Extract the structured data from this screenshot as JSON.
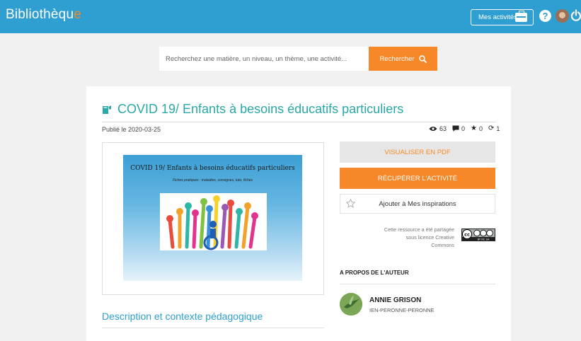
{
  "header": {
    "brand_main": "Bibliothèqu",
    "brand_accent": "e",
    "my_activities": "Mes activités",
    "help": "?"
  },
  "search": {
    "placeholder": "Recherchez une matière, un niveau, un thème, une activité...",
    "button": "Rechercher"
  },
  "resource": {
    "title": "COVID 19/ Enfants à besoins éducatifs particuliers",
    "published": "Publié le 2020-03-25",
    "stats": {
      "views": "63",
      "comments": "0",
      "favorites": "0",
      "shares": "1"
    },
    "preview": {
      "title": "COVID 19/ Enfants à besoins éducatifs particuliers",
      "subtitle": "Fiches pratiques : maladies, consignes, tuto, fiches"
    },
    "actions": {
      "view_pdf": "VISUALISER EN PDF",
      "get_activity": "RÉCUPÉRER L'ACTIVITÉ",
      "add_inspiration": "Ajouter à Mes inspirations"
    },
    "license": "Cette ressource a été partagée sous licence Creative Commons",
    "license_badge": "BY NC SA"
  },
  "author": {
    "section_title": "A PROPOS DE L'AUTEUR",
    "name": "ANNIE GRISON",
    "org": "IEN-PERONNE-PERONNE"
  },
  "description": {
    "title": "Description et contexte pédagogique"
  },
  "colors": {
    "topbar": "#2e9fd0",
    "accent": "#f7882a",
    "title": "#2aa8a5"
  }
}
